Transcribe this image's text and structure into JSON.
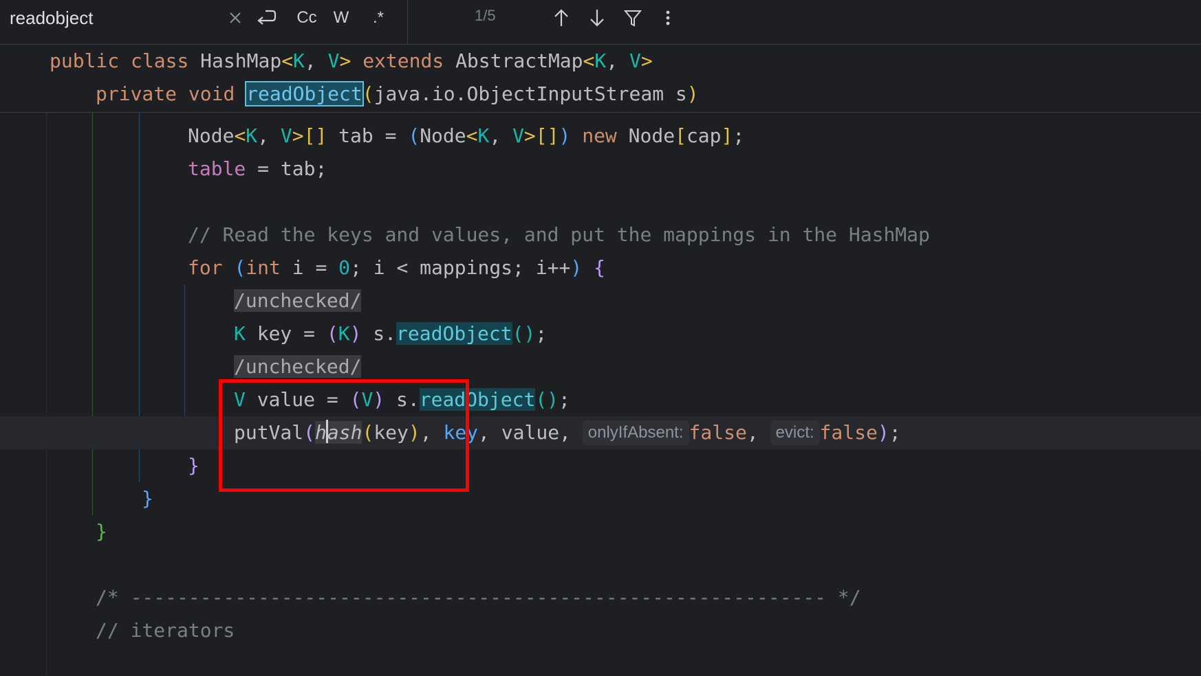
{
  "search": {
    "query": "readobject",
    "match_counter": "1/5",
    "tools": {
      "clear_icon": "close-icon",
      "newline_icon": "newline-icon",
      "match_case": "Cc",
      "words": "W",
      "regex": ".*",
      "prev_icon": "arrow-up-icon",
      "next_icon": "arrow-down-icon",
      "filter_icon": "filter-icon",
      "more_icon": "more-vertical-icon"
    }
  },
  "sticky": {
    "class_line": {
      "kw1": "public",
      "kw2": "class",
      "name": "HashMap",
      "lt": "<",
      "K": "K",
      "comma": ", ",
      "V": "V",
      "gt": ">",
      "extends": "extends",
      "super": "AbstractMap",
      "lt2": "<",
      "K2": "K",
      "comma2": ", ",
      "V2": "V",
      "gt2": ">"
    },
    "method_line": {
      "kw1": "private",
      "kw2": "void",
      "name": "readObject",
      "open": "(",
      "param": "java.io.ObjectInputStream s",
      "close": ")"
    }
  },
  "code": {
    "l1": {
      "t1": "Node",
      "lt": "<",
      "K": "K",
      "c": ", ",
      "V": "V",
      "gt": ">[]",
      "rest1": " tab = ",
      "open": "(",
      "t2": "Node",
      "lt2": "<",
      "K2": "K",
      "c2": ", ",
      "V2": "V",
      "gt2": ">[]",
      "close": ")",
      "sp": " ",
      "new": "new",
      "t3": " Node",
      "ob": "[",
      "cap": "cap",
      "cb": "]",
      "semi": ";"
    },
    "l2": {
      "field": "table",
      "rest": " = tab;"
    },
    "l3": {
      "comment": "// Read the keys and values, and put the mappings in the HashMap"
    },
    "l4": {
      "for": "for",
      "sp": " ",
      "open": "(",
      "int": "int",
      "a": " i = ",
      "zero": "0",
      "b": "; i < mappings; i++",
      "close": ")",
      "sp2": " ",
      "brace": "{"
    },
    "l5": {
      "annotation": "/unchecked/"
    },
    "l6": {
      "K": "K",
      "a": " key = ",
      "open": "(",
      "K2": "K",
      "close": ")",
      "b": " s.",
      "hit": "readObject",
      "paren": "()",
      "semi": ";"
    },
    "l7": {
      "annotation": "/unchecked/"
    },
    "l8": {
      "V": "V",
      "a": " value = ",
      "open": "(",
      "V2": "V",
      "close": ")",
      "b": " s.",
      "hit": "readObject",
      "paren": "()",
      "semi": ";"
    },
    "l9": {
      "fn": "putVal",
      "open": "(",
      "hash_a": "h",
      "hash_b": "ash",
      "open2": "(",
      "key": "key",
      "close2": ")",
      "c1": ", ",
      "key2": "key",
      "c2": ", value, ",
      "hint1": "onlyIfAbsent:",
      "f1": "false",
      "c3": ", ",
      "hint2": "evict:",
      "f2": "false",
      "close": ")",
      "semi": ";"
    },
    "l10": {
      "brace": "}"
    },
    "l11": {
      "brace": "}"
    },
    "l12": {
      "brace": "}"
    },
    "l13": {
      "comment": "/* ------------------------------------------------------------ */"
    },
    "l14": {
      "comment": "// iterators"
    }
  },
  "colors": {
    "background": "#1e1f22",
    "keyword": "#cf8e6d",
    "type_param": "#16baac",
    "search_hit": "#154451",
    "red_box": "#ff0000"
  }
}
